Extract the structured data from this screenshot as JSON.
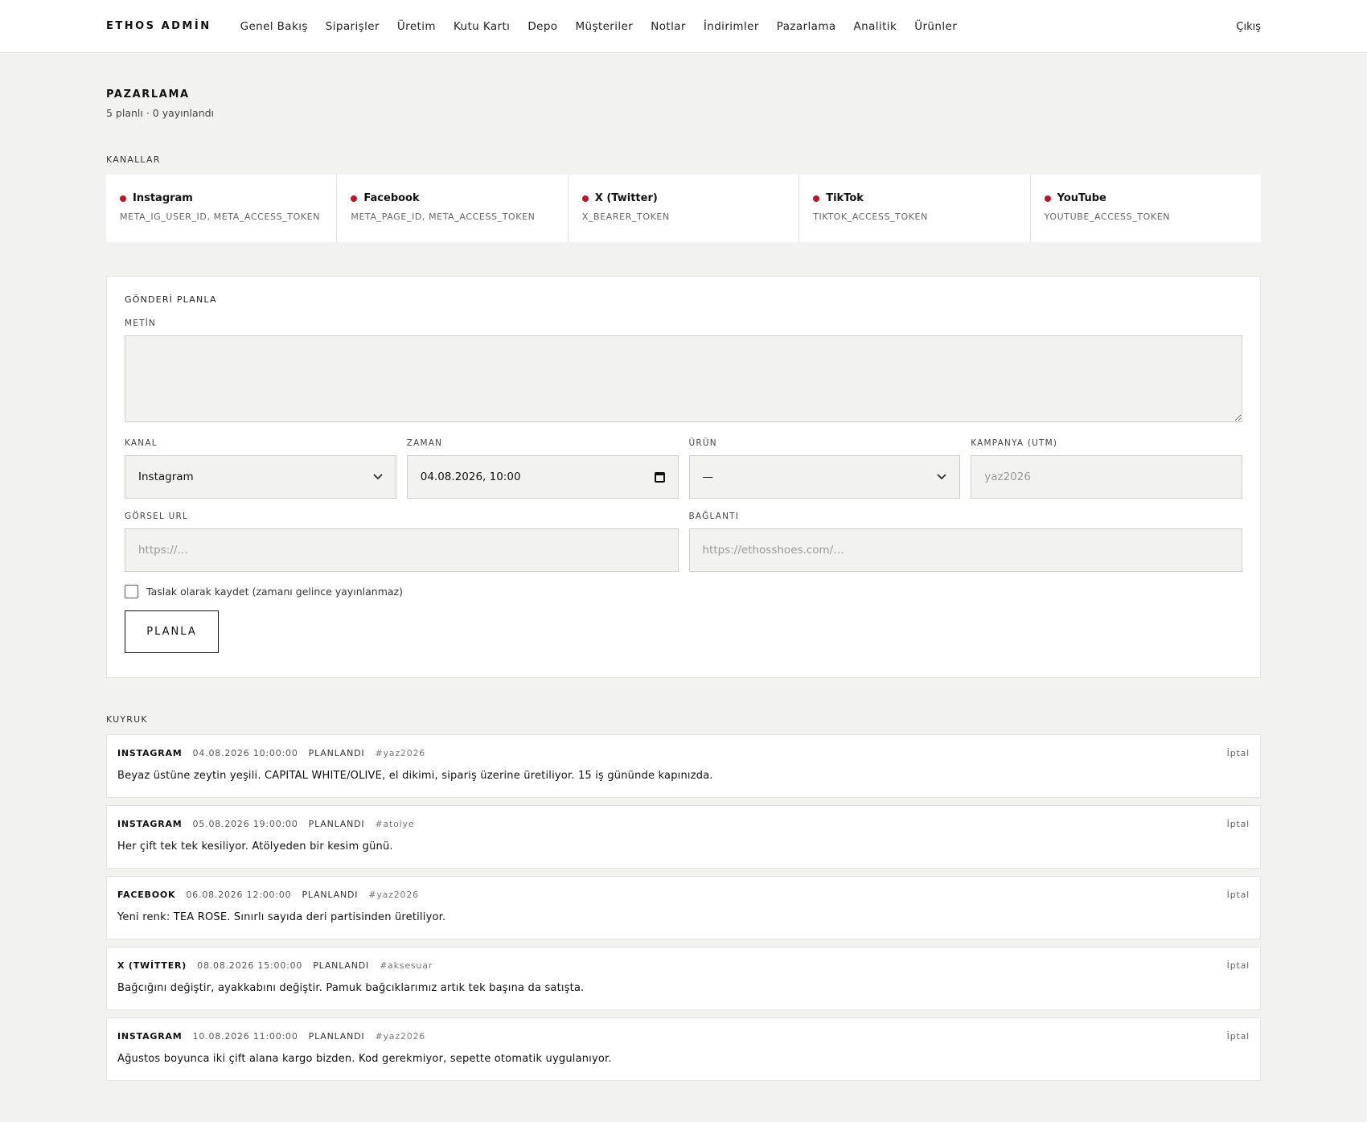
{
  "header": {
    "brand": "ETHOS ADMİN",
    "nav": [
      "Genel Bakış",
      "Siparişler",
      "Üretim",
      "Kutu Kartı",
      "Depo",
      "Müşteriler",
      "Notlar",
      "İndirimler",
      "Pazarlama",
      "Analitik",
      "Ürünler"
    ],
    "logout": "Çıkış"
  },
  "page": {
    "title": "PAZARLAMA",
    "subtitle": "5 planlı · 0 yayınlandı"
  },
  "channels": {
    "label": "KANALLAR",
    "status_color": "#c0152b",
    "items": [
      {
        "name": "Instagram",
        "env": "META_IG_USER_ID, META_ACCESS_TOKEN"
      },
      {
        "name": "Facebook",
        "env": "META_PAGE_ID, META_ACCESS_TOKEN"
      },
      {
        "name": "X (Twitter)",
        "env": "X_BEARER_TOKEN"
      },
      {
        "name": "TikTok",
        "env": "TIKTOK_ACCESS_TOKEN"
      },
      {
        "name": "YouTube",
        "env": "YOUTUBE_ACCESS_TOKEN"
      }
    ]
  },
  "form": {
    "title": "GÖNDERİ PLANLA",
    "text_label": "METİN",
    "text_value": "",
    "channel_label": "KANAL",
    "channel_value": "Instagram",
    "time_label": "ZAMAN",
    "time_value": "04.08.2026, 10:00",
    "product_label": "ÜRÜN",
    "product_value": "—",
    "campaign_label": "KAMPANYA (UTM)",
    "campaign_placeholder": "yaz2026",
    "image_label": "GÖRSEL URL",
    "image_placeholder": "https://…",
    "link_label": "BAĞLANTI",
    "link_placeholder": "https://ethosshoes.com/…",
    "draft_label": "Taslak olarak kaydet (zamanı gelince yayınlanmaz)",
    "draft_checked": false,
    "submit_label": "PLANLA"
  },
  "queue": {
    "label": "KUYRUK",
    "cancel_label": "İptal",
    "items": [
      {
        "channel": "INSTAGRAM",
        "date": "04.08.2026 10:00:00",
        "status": "PLANLANDI",
        "tag": "#yaz2026",
        "text": "Beyaz üstüne zeytin yeşili. CAPITAL WHITE/OLIVE, el dikimi, sipariş üzerine üretiliyor. 15 iş gününde kapınızda."
      },
      {
        "channel": "INSTAGRAM",
        "date": "05.08.2026 19:00:00",
        "status": "PLANLANDI",
        "tag": "#atolye",
        "text": "Her çift tek tek kesiliyor. Atölyeden bir kesim günü."
      },
      {
        "channel": "FACEBOOK",
        "date": "06.08.2026 12:00:00",
        "status": "PLANLANDI",
        "tag": "#yaz2026",
        "text": "Yeni renk: TEA ROSE. Sınırlı sayıda deri partisinden üretiliyor."
      },
      {
        "channel": "X (TWİTTER)",
        "date": "08.08.2026 15:00:00",
        "status": "PLANLANDI",
        "tag": "#aksesuar",
        "text": "Bağcığını değiştir, ayakkabını değiştir. Pamuk bağcıklarımız artık tek başına da satışta."
      },
      {
        "channel": "INSTAGRAM",
        "date": "10.08.2026 11:00:00",
        "status": "PLANLANDI",
        "tag": "#yaz2026",
        "text": "Ağustos boyunca iki çift alana kargo bizden. Kod gerekmiyor, sepette otomatik uygulanıyor."
      }
    ]
  }
}
